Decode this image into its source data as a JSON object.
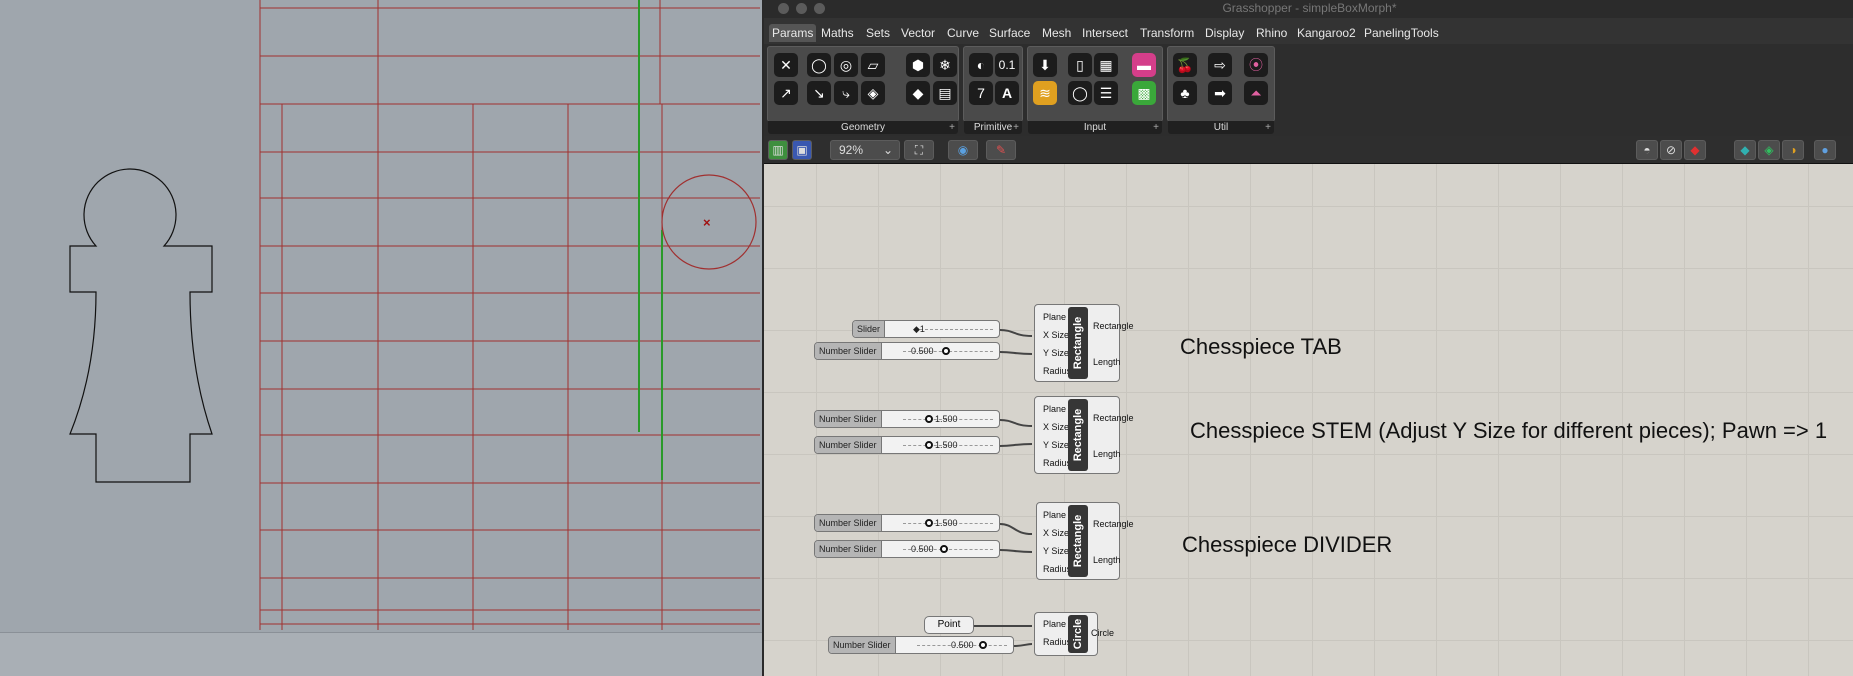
{
  "window": {
    "title": "Grasshopper - simpleBoxMorph*"
  },
  "menu": {
    "tabs": [
      "Params",
      "Maths",
      "Sets",
      "Vector",
      "Curve",
      "Surface",
      "Mesh",
      "Intersect",
      "Transform",
      "Display",
      "Rhino",
      "Kangaroo2",
      "PanelingTools"
    ]
  },
  "ribbon": {
    "groups": [
      "Geometry",
      "Primitive",
      "Input",
      "Util"
    ],
    "primitive_labels": {
      "number": "0.1",
      "seven": "7",
      "text": "A"
    }
  },
  "toolbar": {
    "zoom": "92%"
  },
  "canvas": {
    "notes": [
      "Chesspiece TAB",
      "Chesspiece STEM (Adjust Y Size for different pieces); Pawn => 1",
      "Chesspiece DIVIDER"
    ],
    "sliders": [
      {
        "label": "Slider",
        "value": "1"
      },
      {
        "label": "Number Slider",
        "value": "0.500"
      },
      {
        "label": "Number Slider",
        "value": "1.500"
      },
      {
        "label": "Number Slider",
        "value": "1.500"
      },
      {
        "label": "Number Slider",
        "value": "1.500"
      },
      {
        "label": "Number Slider",
        "value": "0.500"
      },
      {
        "label": "Number Slider",
        "value": "0.500"
      }
    ],
    "point": {
      "label": "Point"
    },
    "rect_component": {
      "name": "Rectangle",
      "inputs": [
        "Plane",
        "X Size",
        "Y Size",
        "Radius"
      ],
      "outputs": [
        "Rectangle",
        "Length"
      ]
    },
    "circle_component": {
      "name": "Circle",
      "inputs": [
        "Plane",
        "Radius"
      ],
      "outputs": [
        "Circle"
      ]
    }
  }
}
